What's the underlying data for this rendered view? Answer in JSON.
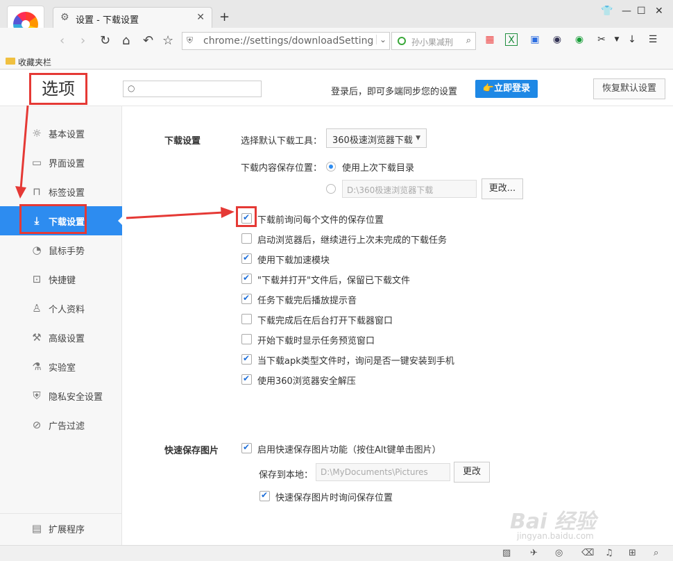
{
  "browser": {
    "tab_title": "设置 - 下载设置",
    "url": "chrome://settings/downloadSettings",
    "search_placeholder": "孙小果减刑"
  },
  "bookmarks": {
    "folder_label": "收藏夹栏"
  },
  "header": {
    "title": "选项",
    "search_placeholder": "",
    "sync_text": "登录后，即可多端同步您的设置",
    "login_label": "👉立即登录",
    "restore_label": "恢复默认设置"
  },
  "sidebar": {
    "items": [
      {
        "label": "基本设置",
        "icon": "gear-icon"
      },
      {
        "label": "界面设置",
        "icon": "window-icon"
      },
      {
        "label": "标签设置",
        "icon": "tab-icon"
      },
      {
        "label": "下载设置",
        "icon": "download-icon",
        "active": true
      },
      {
        "label": "鼠标手势",
        "icon": "mouse-icon"
      },
      {
        "label": "快捷键",
        "icon": "shortcut-icon"
      },
      {
        "label": "个人资料",
        "icon": "user-icon"
      },
      {
        "label": "高级设置",
        "icon": "wrench-icon"
      },
      {
        "label": "实验室",
        "icon": "flask-icon"
      },
      {
        "label": "隐私安全设置",
        "icon": "shield-icon"
      },
      {
        "label": "广告过滤",
        "icon": "block-icon"
      }
    ],
    "extensions_label": "扩展程序"
  },
  "download": {
    "section_title": "下载设置",
    "tool_label": "选择默认下载工具：",
    "tool_value": "360极速浏览器下载",
    "location_label": "下载内容保存位置：",
    "option_last_dir": "使用上次下载目录",
    "custom_path": "D:\\360极速浏览器下载",
    "change_label": "更改...",
    "checkboxes": [
      {
        "label": "下载前询问每个文件的保存位置",
        "checked": true
      },
      {
        "label": "启动浏览器后，继续进行上次未完成的下载任务",
        "checked": false
      },
      {
        "label": "使用下载加速模块",
        "checked": true
      },
      {
        "label": "\"下载并打开\"文件后，保留已下载文件",
        "checked": true
      },
      {
        "label": "任务下载完后播放提示音",
        "checked": true
      },
      {
        "label": "下载完成后在后台打开下载器窗口",
        "checked": false
      },
      {
        "label": "开始下载时显示任务预览窗口",
        "checked": false
      },
      {
        "label": "当下载apk类型文件时，询问是否一键安装到手机",
        "checked": true
      },
      {
        "label": "使用360浏览器安全解压",
        "checked": true
      }
    ]
  },
  "quicksave": {
    "section_title": "快速保存图片",
    "enable_label": "启用快速保存图片功能（按住Alt键单击图片）",
    "enable_checked": true,
    "path_label": "保存到本地：",
    "path_value": "D:\\MyDocuments\\Pictures",
    "change_label": "更改",
    "ask_label": "快速保存图片时询问保存位置",
    "ask_checked": true
  },
  "watermark": {
    "text": "Bai 经验",
    "sub": "jingyan.baidu.com"
  },
  "colors": {
    "accent": "#2d8cf0",
    "highlight": "#e53935",
    "login": "#1e88e5"
  }
}
